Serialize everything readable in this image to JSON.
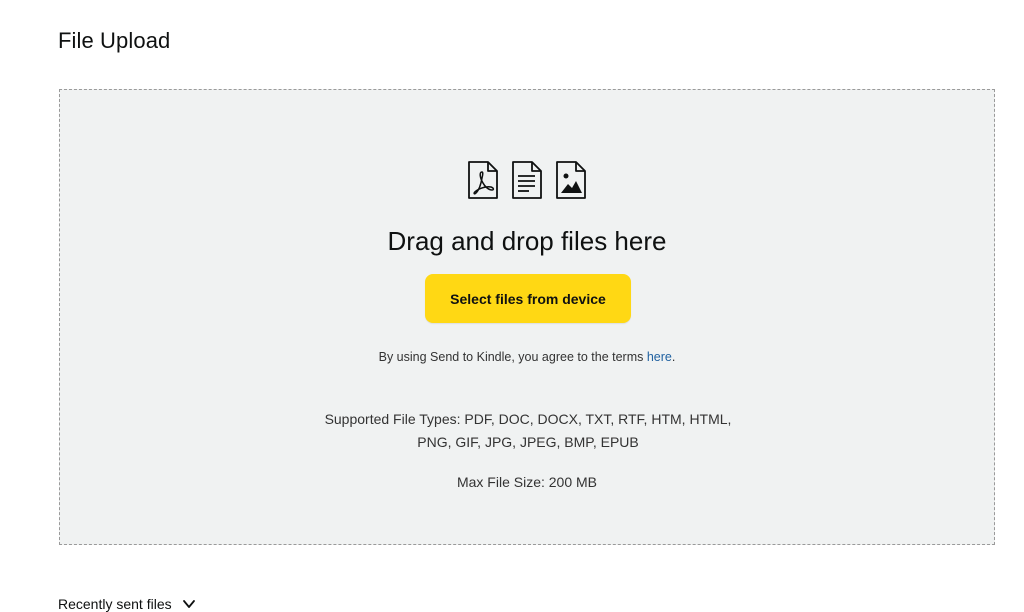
{
  "page": {
    "title": "File Upload"
  },
  "dropzone": {
    "icons": [
      "pdf-file-icon",
      "document-file-icon",
      "image-file-icon"
    ],
    "headline": "Drag and drop files here",
    "select_button_label": "Select files from device",
    "terms_text": "By using Send to Kindle, you agree to the terms ",
    "terms_link": "here",
    "terms_end": ".",
    "supported_types": "Supported File Types: PDF, DOC, DOCX, TXT, RTF, HTM, HTML, PNG, GIF, JPG, JPEG, BMP, EPUB",
    "max_size": "Max File Size: 200 MB"
  },
  "recent": {
    "label": "Recently sent files",
    "icon": "chevron-down-icon"
  },
  "colors": {
    "button_bg": "#ffd814",
    "dropzone_bg": "#f0f2f2",
    "link": "#2162a1"
  }
}
